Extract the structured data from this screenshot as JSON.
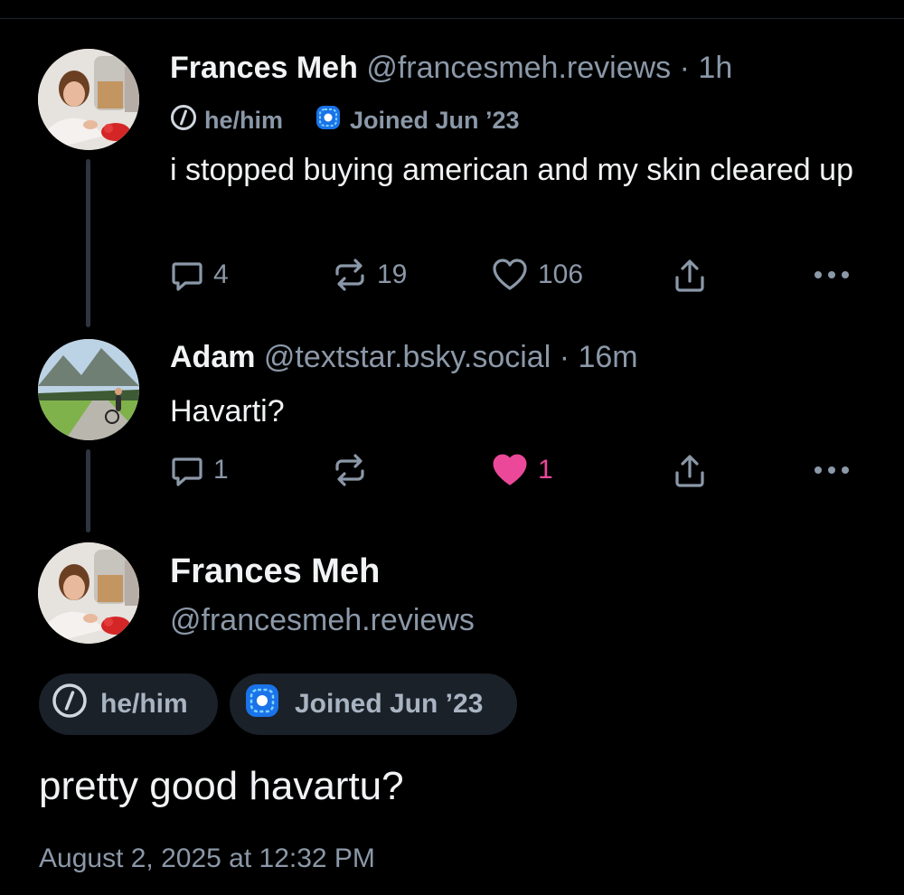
{
  "colors": {
    "background": "#000000",
    "muted": "#8b98a8",
    "like_active": "#ec4899",
    "pill_bg": "#1b2129",
    "thread_line": "#2e3540"
  },
  "reply_parent": {
    "author_name": "Frances Meh",
    "handle": "@francesmeh.reviews",
    "separator": "·",
    "time": "1h",
    "pronouns": "he/him",
    "joined": "Joined Jun ’23",
    "text": "i stopped buying american and my skin cleared up",
    "reply_count": "4",
    "repost_count": "19",
    "like_count": "106"
  },
  "reply": {
    "author_name": "Adam",
    "handle": "@textstar.bsky.social",
    "separator": "·",
    "time": "16m",
    "text": "Havarti?",
    "reply_count": "1",
    "repost_count": "",
    "like_count": "1",
    "liked": true
  },
  "focused_post": {
    "author_name": "Frances Meh",
    "handle": "@francesmeh.reviews",
    "pronouns": "he/him",
    "joined": "Joined Jun ’23",
    "text": "pretty good havartu?",
    "timestamp": "August 2, 2025 at 12:32 PM"
  },
  "icons": {
    "reply": "reply-bubble-icon",
    "repost": "repost-arrows-icon",
    "like": "heart-icon",
    "share": "share-upload-icon",
    "more": "more-dots-icon",
    "pronouns": "pronoun-badge-icon",
    "joined": "joined-badge-icon"
  }
}
